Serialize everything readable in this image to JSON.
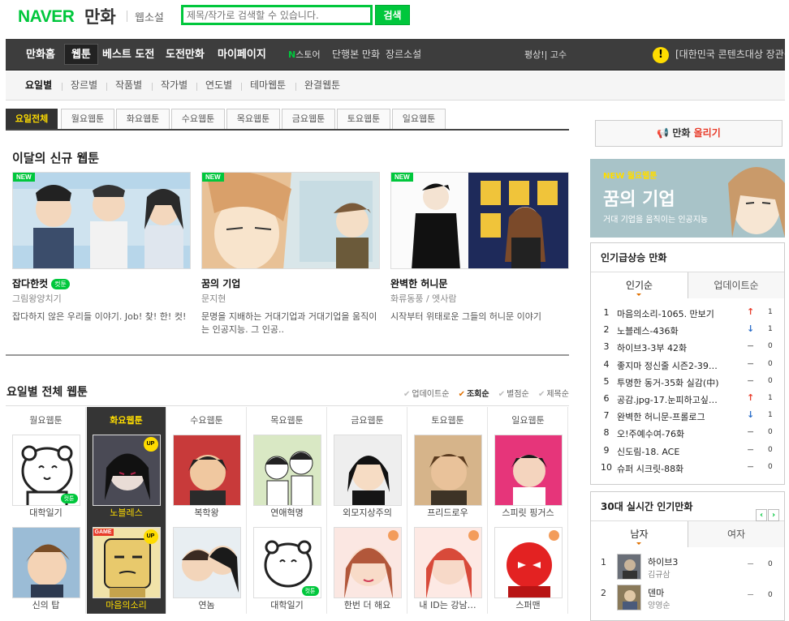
{
  "header": {
    "brand": "NAVER",
    "service": "만화",
    "websoseol": "웹소설",
    "search_placeholder": "제목/작가로 검색할 수 있습니다.",
    "search_button": "검색"
  },
  "nav": {
    "items": [
      "만화홈",
      "웹툰",
      "베스트 도전",
      "도전만화",
      "마이페이지"
    ],
    "store_n": "N",
    "store_label": "스토어",
    "store_items": [
      "단행본 만화",
      "장르소설"
    ],
    "user": "평상!| 고수",
    "notice": "[대한민국 콘텐츠대상 장관상"
  },
  "subnav": {
    "items": [
      "요일별",
      "장르별",
      "작품별",
      "작가별",
      "연도별",
      "테마웹툰",
      "완결웹툰"
    ]
  },
  "day_tabs": [
    "요일전체",
    "월요웹툰",
    "화요웹툰",
    "수요웹툰",
    "목요웹툰",
    "금요웹툰",
    "토요웹툰",
    "일요웹툰"
  ],
  "new_section": {
    "title": "이달의 신규 웹툰",
    "badge": "NEW",
    "cut_badge": "컷툰",
    "cards": [
      {
        "title": "잡다한컷",
        "author": "그림왕양치기",
        "desc": "잡다하지 않은 우리들 이야기. Job! 찾! 한! 컷!"
      },
      {
        "title": "꿈의 기업",
        "author": "문지현",
        "desc": "문명을 지배하는 거대기업과 거대기업을 움직이는 인공지능. 그 인공.."
      },
      {
        "title": "완벽한 허니문",
        "author": "화류동풍 / 엣사람",
        "desc": "시작부터 위태로운 그들의 허니문 이야기"
      }
    ]
  },
  "all_section": {
    "title": "요일별 전체 웹툰",
    "sort": [
      "업데이트순",
      "조회순",
      "별점순",
      "제목순"
    ],
    "columns": [
      {
        "day": "월요웹툰",
        "items": [
          "대학일기",
          "신의 탑"
        ]
      },
      {
        "day": "화요웹툰",
        "items": [
          "노블레스",
          "마음의소리"
        ]
      },
      {
        "day": "수요웹툰",
        "items": [
          "복학왕",
          "연놈"
        ]
      },
      {
        "day": "목요웹툰",
        "items": [
          "연애혁명",
          "대학일기"
        ]
      },
      {
        "day": "금요웹툰",
        "items": [
          "외모지상주의",
          "한번 더 해요"
        ]
      },
      {
        "day": "토요웹툰",
        "items": [
          "프리드로우",
          "내 ID는 강남…"
        ]
      },
      {
        "day": "일요웹툰",
        "items": [
          "스피릿 핑거스",
          "스퍼맨"
        ]
      }
    ],
    "up_badge": "UP",
    "game_badge": "GAME"
  },
  "right": {
    "upload_icon": "megaphone-icon",
    "upload_label_1": "만화 ",
    "upload_label_2": "올리기",
    "banner_tag": "NEW 월요웹툰",
    "banner_title": "꿈의 기업",
    "banner_sub": "거대 기업을 움직이는 인공지능",
    "rising": {
      "title": "인기급상승 만화",
      "tabs": [
        "인기순",
        "업데이트순"
      ],
      "rows": [
        {
          "n": "1",
          "t": "마음의소리-1065. 만보기",
          "dir": "up",
          "c": "1"
        },
        {
          "n": "2",
          "t": "노블레스-436화",
          "dir": "down",
          "c": "1"
        },
        {
          "n": "3",
          "t": "하이브3-3부 42화",
          "dir": "same",
          "c": "0"
        },
        {
          "n": "4",
          "t": "좋지마 정신줄 시즌2-39…",
          "dir": "same",
          "c": "0"
        },
        {
          "n": "5",
          "t": "투명한 동거-35화 실감(中)",
          "dir": "same",
          "c": "0"
        },
        {
          "n": "6",
          "t": "공감.jpg-17.눈피하고싶…",
          "dir": "up",
          "c": "1"
        },
        {
          "n": "7",
          "t": "완벽한 허니문-프롤로그",
          "dir": "down",
          "c": "1"
        },
        {
          "n": "8",
          "t": "오!주예수여-76화",
          "dir": "same",
          "c": "0"
        },
        {
          "n": "9",
          "t": "신도림-18. ACE",
          "dir": "same",
          "c": "0"
        },
        {
          "n": "10",
          "t": "슈퍼 시크릿-88화",
          "dir": "same",
          "c": "0"
        }
      ]
    },
    "realtime": {
      "title": "30대 실시간 인기만화",
      "tabs": [
        "남자",
        "여자"
      ],
      "rows": [
        {
          "n": "1",
          "t": "하이브3",
          "a": "김규삼",
          "c": "0"
        },
        {
          "n": "2",
          "t": "덴마",
          "a": "양영순",
          "c": "0"
        }
      ]
    }
  }
}
